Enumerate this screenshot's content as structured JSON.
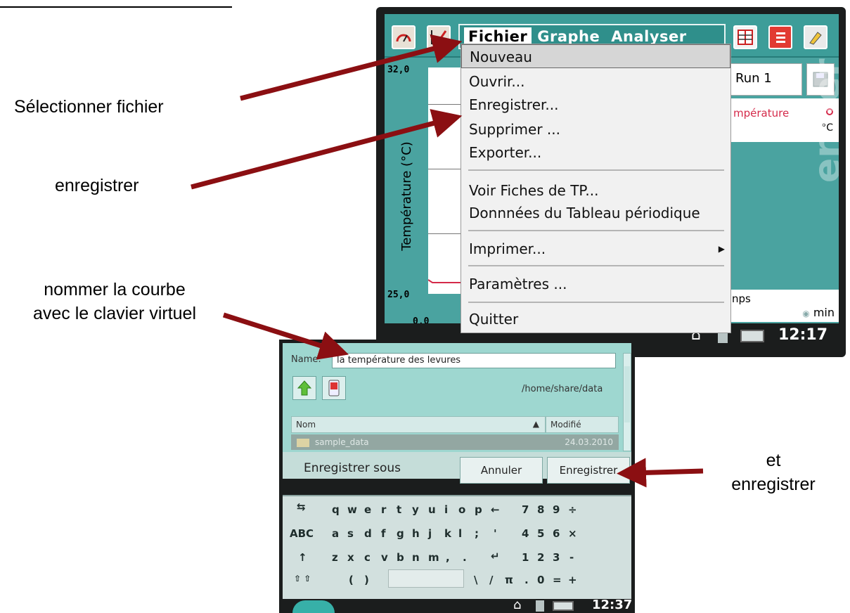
{
  "annotations": {
    "select_file": "Sélectionner fichier",
    "save": "enregistrer",
    "name_curve": "nommer la courbe\navec le clavier virtuel",
    "and_save": "et\nenregistrer"
  },
  "device1": {
    "menu_tabs": [
      "Fichier",
      "Graphe",
      "Analyser"
    ],
    "file_menu": {
      "items": [
        "Nouveau",
        "Ouvrir...",
        "Enregistrer...",
        "Supprimer ...",
        "Exporter...",
        "Voir Fiches de TP...",
        "Donnnées du Tableau périodique",
        "Imprimer...",
        "Paramètres ...",
        "Quitter"
      ],
      "highlighted": "Nouveau"
    },
    "graph": {
      "y_axis_label": "Température (°C)",
      "y_max": "32,0",
      "y_min": "25,0",
      "x_min": "0,0"
    },
    "run_label": "Run 1",
    "sensor": {
      "name": "mpérature",
      "unit": "°C"
    },
    "time_column": {
      "name": "nps",
      "unit": "min"
    },
    "vernier_logo": "ernier",
    "clock": "12:17"
  },
  "device2": {
    "name_label": "Name:",
    "name_value": "la température des levures",
    "path": "/home/share/data",
    "columns": [
      "Nom",
      "Modifié"
    ],
    "files": [
      {
        "name": "sample_data",
        "modified": "24.03.2010"
      }
    ],
    "dialog_title": "Enregistrer sous",
    "cancel_label": "Annuler",
    "save_label": "Enregistrer",
    "keyboard_rows": [
      [
        "q",
        "w",
        "e",
        "r",
        "t",
        "y",
        "u",
        "i",
        "o",
        "p",
        "←",
        "7",
        "8",
        "9",
        "÷"
      ],
      [
        "ABC",
        "a",
        "s",
        "d",
        "f",
        "g",
        "h",
        "j",
        "k",
        "l",
        ";",
        "'",
        "4",
        "5",
        "6",
        "×"
      ],
      [
        "↑",
        "z",
        "x",
        "c",
        "v",
        "b",
        "n",
        "m",
        ",",
        ".",
        "↵",
        "1",
        "2",
        "3",
        "-"
      ],
      [
        "(",
        ")",
        "\\",
        "/",
        "π",
        ".",
        "0",
        "=",
        "+"
      ]
    ],
    "clock": "12:37"
  },
  "colors": {
    "teal": "#3d9d99",
    "dialog_teal": "#9ed7d0",
    "arrow": "#8b0f12",
    "sensor_red": "#d42a4a"
  }
}
